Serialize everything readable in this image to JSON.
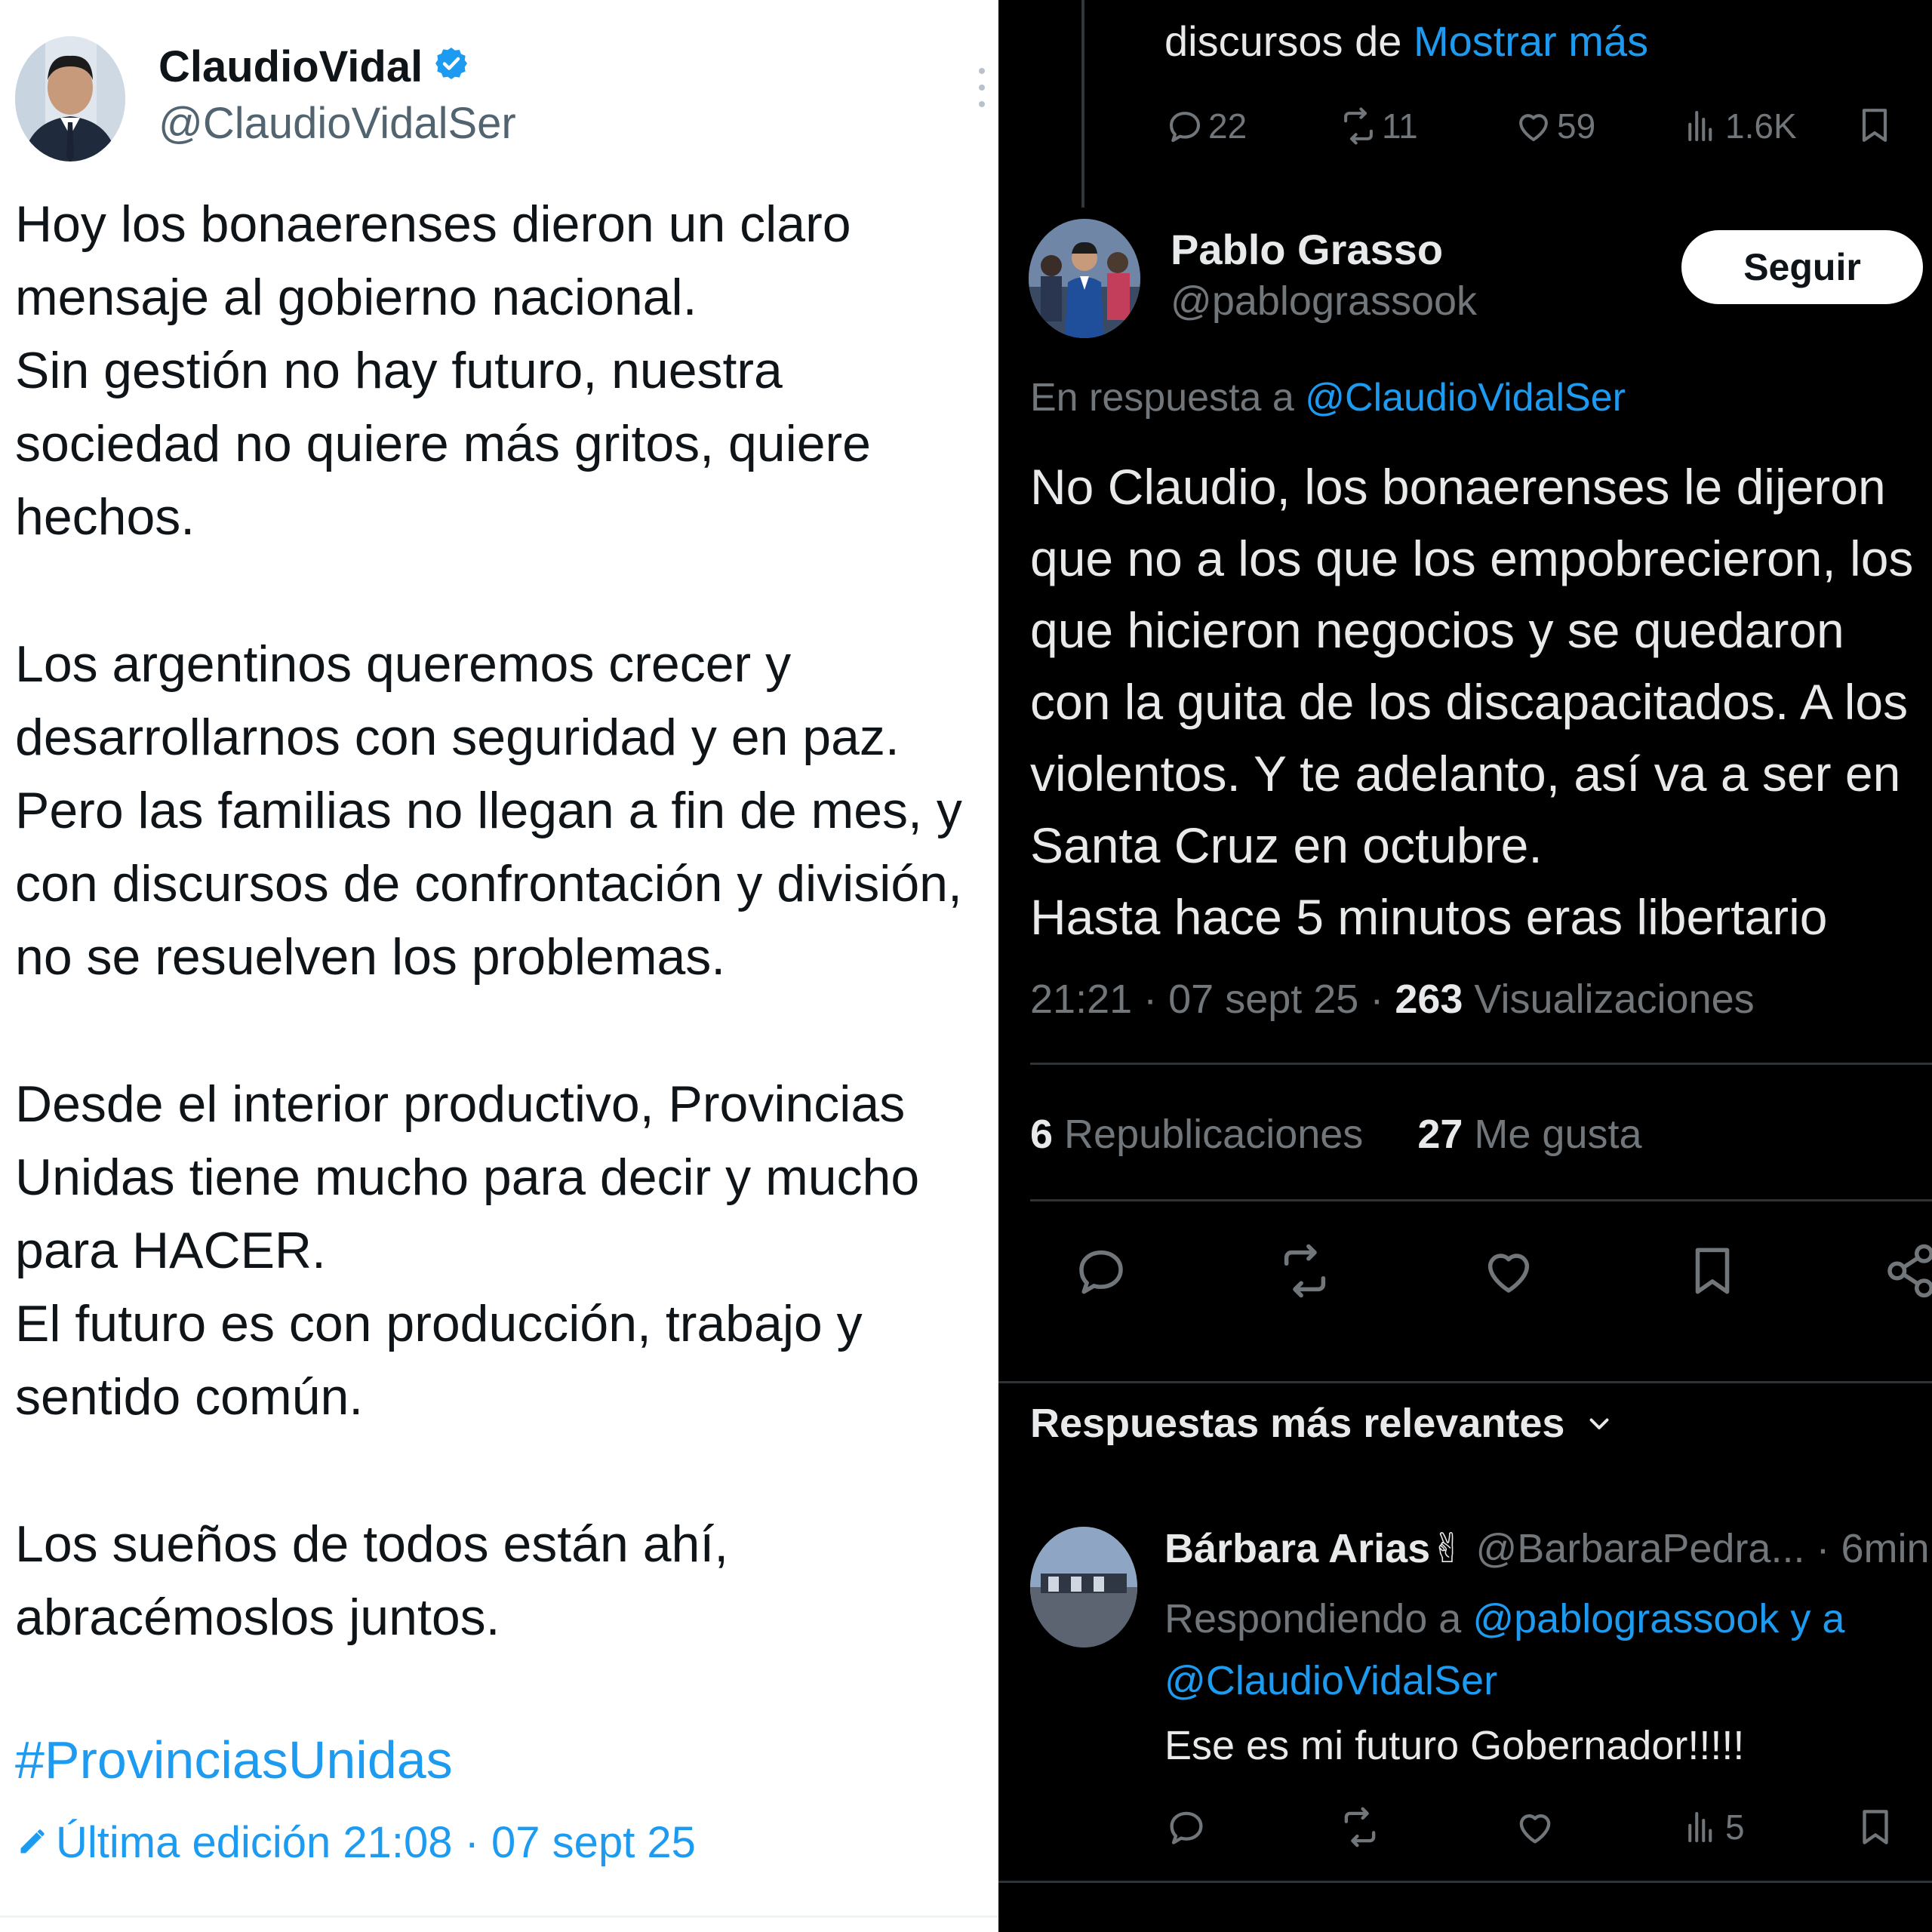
{
  "left_post": {
    "author_name": "ClaudioVidal",
    "handle": "@ClaudioVidalSer",
    "paragraphs": [
      "Hoy los bonaerenses dieron un claro\nmensaje al gobierno nacional.\nSin gestión no hay futuro, nuestra\nsociedad no quiere más gritos, quiere\nhechos.",
      "Los argentinos queremos crecer y\ndesarrollarnos con seguridad y en paz.\nPero las familias no llegan a fin de mes, y\ncon discursos de confrontación y división,\nno se resuelven los problemas.",
      "Desde el interior productivo, Provincias\nUnidas tiene mucho para decir y mucho\npara HACER.\nEl futuro es con producción, trabajo y\nsentido común.",
      "Los sueños de todos están ahí,\nabracémoslos juntos."
    ],
    "hashtag": "#ProvinciasUnidas",
    "edited_label": "Última edición 21:08 · 07 sept 25"
  },
  "right_thread": {
    "prev_post": {
      "text": "discursos de ",
      "show_more": "Mostrar más",
      "stats": {
        "replies": "22",
        "reposts": "11",
        "likes": "59",
        "views": "1.6K"
      }
    },
    "main_post": {
      "author_name": "Pablo Grasso",
      "handle": "@pablograssook",
      "follow_label": "Seguir",
      "reply_prefix": "En respuesta a ",
      "reply_handle": "@ClaudioVidalSer",
      "body": "No Claudio, los bonaerenses le dijeron\nque no a los que los empobrecieron, los\nque hicieron negocios y se quedaron\ncon la guita de los discapacitados. A los\nviolentos. Y te adelanto, así va a ser en\nSanta Cruz en octubre.\nHasta hace 5 minutos eras libertario",
      "meta_prefix": "21:21 · 07 sept 25 · ",
      "views_count": "263",
      "views_label": " Visualizaciones",
      "reposts_count": "6",
      "reposts_label": " Republicaciones",
      "likes_count": "27",
      "likes_label": " Me gusta"
    },
    "sort_label": "Respuestas más relevantes",
    "reply": {
      "author_name": "Bárbara Arias✌",
      "handle_time": " @BarbaraPedra... · 6min",
      "responding_prefix": "Respondiendo a ",
      "responding_targets_line1": "@pablograssook y a",
      "responding_targets_line2": "@ClaudioVidalSer",
      "text": "Ese es mi futuro Gobernador!!!!!",
      "views": "5"
    }
  },
  "colors": {
    "accent_blue": "#1d9bf0",
    "dark_bg": "#000000",
    "light_bg": "#ffffff",
    "dim_text": "#71767b"
  }
}
